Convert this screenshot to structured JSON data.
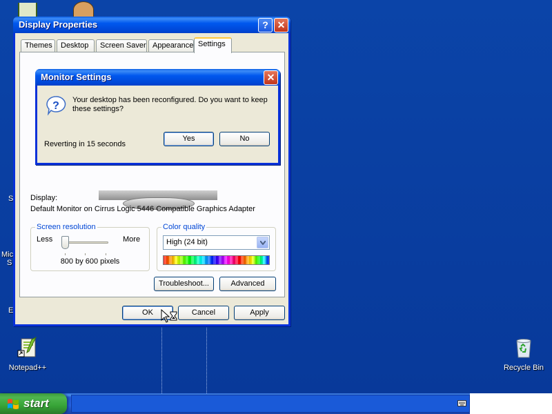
{
  "desktop": {
    "icons": [
      {
        "label": "Notepad++",
        "icon": "notepad-plus-plus-icon"
      },
      {
        "label": "Recycle Bin",
        "icon": "recycle-bin-icon"
      }
    ],
    "partial_labels": [
      "S",
      "Mic",
      "S",
      "E"
    ]
  },
  "display_properties": {
    "title": "Display Properties",
    "tabs": [
      {
        "label": "Themes",
        "active": false
      },
      {
        "label": "Desktop",
        "active": false
      },
      {
        "label": "Screen Saver",
        "active": false
      },
      {
        "label": "Appearance",
        "active": false
      },
      {
        "label": "Settings",
        "active": true
      }
    ],
    "display_label": "Display:",
    "display_value": "Default Monitor on Cirrus Logic 5446 Compatible Graphics Adapter",
    "screen_resolution": {
      "legend": "Screen resolution",
      "less_label": "Less",
      "more_label": "More",
      "value": "800 by 600 pixels",
      "slider_fraction": 0.0
    },
    "color_quality": {
      "legend": "Color quality",
      "selected": "High (24 bit)"
    },
    "buttons": {
      "troubleshoot": "Troubleshoot...",
      "advanced": "Advanced",
      "ok": "OK",
      "cancel": "Cancel",
      "apply": "Apply"
    }
  },
  "monitor_settings": {
    "title": "Monitor Settings",
    "message_line1": "Your desktop has been reconfigured.  Do you want to keep",
    "message_line2": "these settings?",
    "countdown": "Reverting in 15 seconds",
    "yes_label": "Yes",
    "no_label": "No"
  },
  "taskbar": {
    "start_label": "start"
  },
  "colors": {
    "desktop_bg": "#0b44a8",
    "title_bar": "#0058ee",
    "window_face": "#ece9d8",
    "group_legend": "#0046d5",
    "close_button": "#c2351a",
    "start_button": "#37a437"
  }
}
